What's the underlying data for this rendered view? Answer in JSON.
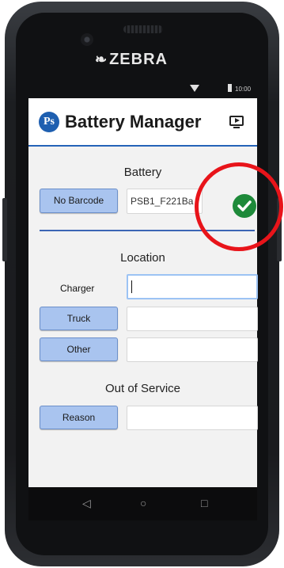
{
  "device": {
    "brand": "ZEBRA",
    "brand_mark": "❧"
  },
  "statusbar": {
    "time": "10:00"
  },
  "app": {
    "title": "Battery Manager",
    "logo_text": "Ps"
  },
  "battery": {
    "section_label": "Battery",
    "no_barcode_label": "No Barcode",
    "barcode_value": "PSB1_F221Ba",
    "status": "valid"
  },
  "location": {
    "section_label": "Location",
    "charger_label": "Charger",
    "charger_value": "",
    "truck_label": "Truck",
    "truck_value": "",
    "other_label": "Other",
    "other_value": ""
  },
  "out_of_service": {
    "section_label": "Out of Service",
    "reason_label": "Reason",
    "reason_value": ""
  },
  "nav": {
    "back": "◁",
    "home": "○",
    "recents": "□"
  },
  "colors": {
    "accent": "#2563b8",
    "button_bg": "#a9c4ef",
    "valid_green": "#1e8a3a",
    "highlight_ring": "#e8141a"
  }
}
